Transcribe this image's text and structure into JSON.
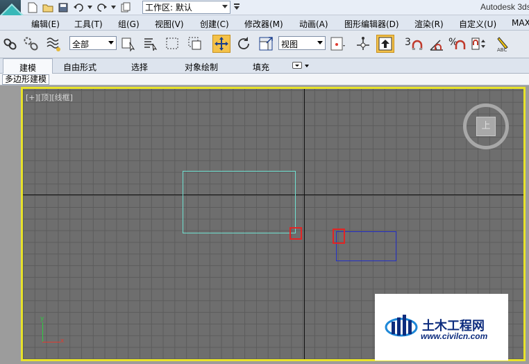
{
  "titlebar": {
    "workspace_value": "工作区: 默认",
    "app_title": "Autodesk 3ds"
  },
  "menubar": {
    "items": [
      "编辑(E)",
      "工具(T)",
      "组(G)",
      "视图(V)",
      "创建(C)",
      "修改器(M)",
      "动画(A)",
      "图形编辑器(D)",
      "渲染(R)",
      "自定义(U)",
      "MAX"
    ]
  },
  "toolbar": {
    "selection_filter": "全部",
    "reference_coord": "视图",
    "snap_label": "3",
    "angle_snap_label": "%"
  },
  "ribbon": {
    "tabs": [
      "建模",
      "自由形式",
      "选择",
      "对象绘制",
      "填充"
    ],
    "active_tab": "建模",
    "subpanel_label": "多边形建模"
  },
  "viewport": {
    "label": "[+][顶][线框]",
    "navcube_face": "上",
    "axis_x": "x",
    "axis_y": "y",
    "border_color": "#e8e32a"
  },
  "watermark": {
    "title": "土木工程网",
    "url": "www.civilcn.com"
  }
}
